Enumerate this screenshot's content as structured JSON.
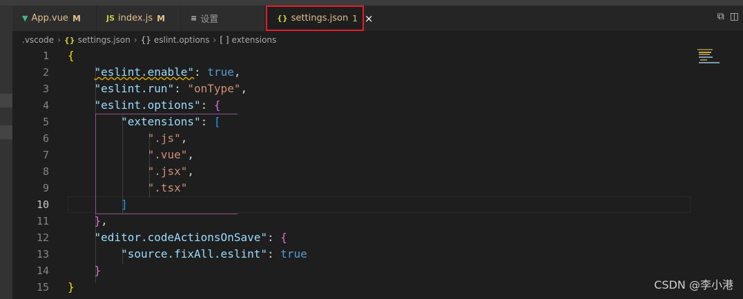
{
  "tabs": [
    {
      "icon": "▼",
      "label": "App.vue",
      "badge": "M",
      "icon_color": "#41b883",
      "label_color": "#e2c08d"
    },
    {
      "icon": "JS",
      "label": "index.js",
      "badge": "M",
      "icon_color": "#cbcb41",
      "label_color": "#e2c08d"
    },
    {
      "icon": "≡",
      "label": "设置",
      "badge": "",
      "icon_color": "#c5c5c5",
      "label_color": "#969696"
    },
    {
      "icon": "{}",
      "label": "settings.json",
      "badge": "1",
      "icon_color": "#cbcb41",
      "label_color": "#e2c08d",
      "active": true
    }
  ],
  "tab_close": "×",
  "tab_tools": {
    "split_icon": "split-editor-icon",
    "layout_icon": "layout-icon",
    "split_glyph": "⧉",
    "layout_glyph": "◫"
  },
  "breadcrumb": {
    "folder": ".vscode",
    "file_icon": "{}",
    "file": "settings.json",
    "obj_icon": "{}",
    "obj": "eslint.options",
    "arr_icon": "[ ]",
    "arr": "extensions",
    "sep": "›"
  },
  "lines": [
    {
      "n": "1",
      "tokens": [
        {
          "t": "{",
          "c": "y"
        }
      ]
    },
    {
      "n": "2",
      "tokens": [
        {
          "t": "    ",
          "c": "p"
        },
        {
          "t": "\"eslint.enable\"",
          "c": "k",
          "squig": true
        },
        {
          "t": ": ",
          "c": "p"
        },
        {
          "t": "true",
          "c": "b"
        },
        {
          "t": ",",
          "c": "p"
        }
      ]
    },
    {
      "n": "3",
      "tokens": [
        {
          "t": "    ",
          "c": "p"
        },
        {
          "t": "\"eslint.run\"",
          "c": "k"
        },
        {
          "t": ": ",
          "c": "p"
        },
        {
          "t": "\"onType\"",
          "c": "s"
        },
        {
          "t": ",",
          "c": "p"
        }
      ]
    },
    {
      "n": "4",
      "tokens": [
        {
          "t": "    ",
          "c": "p"
        },
        {
          "t": "\"eslint.options\"",
          "c": "k"
        },
        {
          "t": ": ",
          "c": "p"
        },
        {
          "t": "{",
          "c": "m"
        }
      ]
    },
    {
      "n": "5",
      "tokens": [
        {
          "t": "        ",
          "c": "p"
        },
        {
          "t": "\"extensions\"",
          "c": "k"
        },
        {
          "t": ": ",
          "c": "p"
        },
        {
          "t": "[",
          "c": "c"
        }
      ]
    },
    {
      "n": "6",
      "tokens": [
        {
          "t": "            ",
          "c": "p"
        },
        {
          "t": "\".js\"",
          "c": "s"
        },
        {
          "t": ",",
          "c": "p"
        }
      ]
    },
    {
      "n": "7",
      "tokens": [
        {
          "t": "            ",
          "c": "p"
        },
        {
          "t": "\".vue\"",
          "c": "s"
        },
        {
          "t": ",",
          "c": "p"
        }
      ]
    },
    {
      "n": "8",
      "tokens": [
        {
          "t": "            ",
          "c": "p"
        },
        {
          "t": "\".jsx\"",
          "c": "s"
        },
        {
          "t": ",",
          "c": "p"
        }
      ]
    },
    {
      "n": "9",
      "tokens": [
        {
          "t": "            ",
          "c": "p"
        },
        {
          "t": "\".tsx\"",
          "c": "s"
        }
      ]
    },
    {
      "n": "10",
      "tokens": [
        {
          "t": "        ",
          "c": "p"
        },
        {
          "t": "]",
          "c": "c"
        }
      ],
      "current": true
    },
    {
      "n": "11",
      "tokens": [
        {
          "t": "    ",
          "c": "p"
        },
        {
          "t": "}",
          "c": "m"
        },
        {
          "t": ",",
          "c": "p"
        }
      ]
    },
    {
      "n": "12",
      "tokens": [
        {
          "t": "    ",
          "c": "p"
        },
        {
          "t": "\"editor.codeActionsOnSave\"",
          "c": "k"
        },
        {
          "t": ": ",
          "c": "p"
        },
        {
          "t": "{",
          "c": "m"
        }
      ]
    },
    {
      "n": "13",
      "tokens": [
        {
          "t": "        ",
          "c": "p"
        },
        {
          "t": "\"source.fixAll.eslint\"",
          "c": "k"
        },
        {
          "t": ": ",
          "c": "p"
        },
        {
          "t": "true",
          "c": "b"
        }
      ]
    },
    {
      "n": "14",
      "tokens": [
        {
          "t": "    ",
          "c": "p"
        },
        {
          "t": "}",
          "c": "m"
        }
      ]
    },
    {
      "n": "15",
      "tokens": [
        {
          "t": "}",
          "c": "y"
        }
      ]
    }
  ],
  "watermark": "CSDN @李小港",
  "colors": {
    "accent_border": "#e51e2b",
    "modified": "#e2c08d"
  }
}
